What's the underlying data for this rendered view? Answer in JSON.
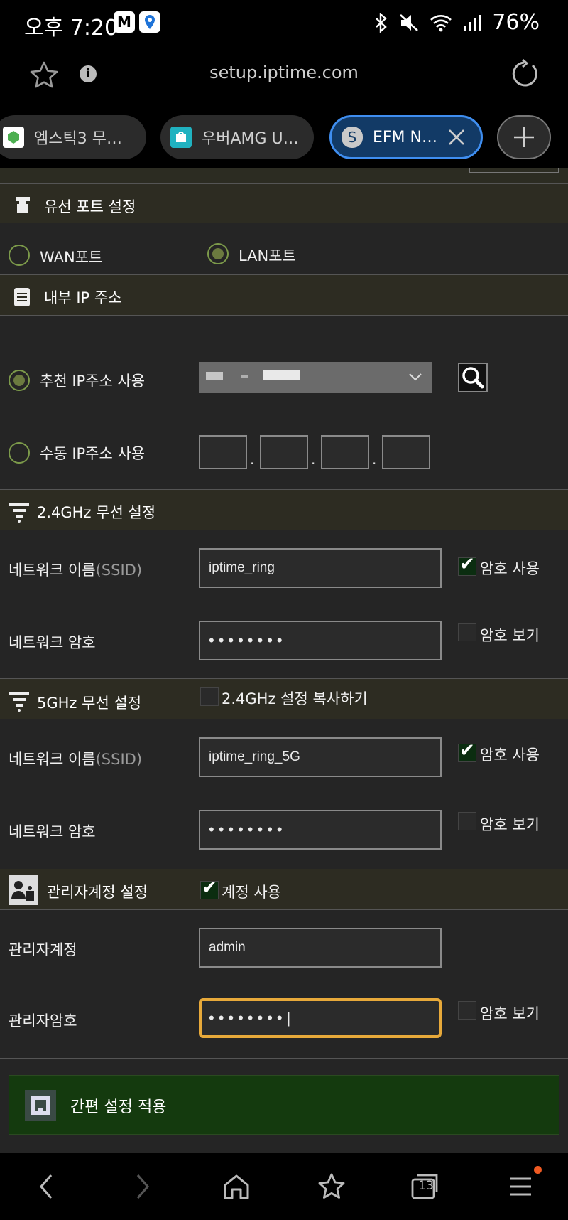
{
  "status_bar": {
    "time": "오후 7:20",
    "battery": "76%",
    "icons": [
      "m-app-icon",
      "map-pin-icon",
      "bluetooth-icon",
      "mute-icon",
      "wifi-icon",
      "signal-icon"
    ]
  },
  "browser": {
    "url": "setup.iptime.com",
    "tabs": [
      {
        "label": "엠스틱3 무…",
        "active": false
      },
      {
        "label": "우버AMG U…",
        "active": false
      },
      {
        "label": "EFM N…",
        "favicon_letter": "S",
        "active": true
      }
    ],
    "tab_count": "13"
  },
  "wired_port": {
    "title": "유선 포트 설정",
    "options": [
      {
        "label": "WAN포트",
        "selected": false
      },
      {
        "label": "LAN포트",
        "selected": true
      }
    ]
  },
  "internal_ip": {
    "title": "내부 IP 주소",
    "recommended_label": "추천 IP주소 사용",
    "recommended_selected": true,
    "manual_label": "수동 IP주소 사용",
    "manual_selected": false,
    "manual_sep": "."
  },
  "wifi_24": {
    "title": "2.4GHz 무선 설정",
    "ssid_label": "네트워크 이름",
    "ssid_sub": "(SSID)",
    "ssid_value": "iptime_ring",
    "use_password_label": "암호 사용",
    "use_password_checked": true,
    "password_label": "네트워크 암호",
    "password_value": "••••••••",
    "show_password_label": "암호 보기",
    "show_password_checked": false
  },
  "wifi_5": {
    "title": "5GHz 무선 설정",
    "copy_label": "2.4GHz 설정 복사하기",
    "copy_checked": false,
    "ssid_label": "네트워크 이름",
    "ssid_sub": "(SSID)",
    "ssid_value": "iptime_ring_5G",
    "use_password_label": "암호 사용",
    "use_password_checked": true,
    "password_label": "네트워크 암호",
    "password_value": "••••••••",
    "show_password_label": "암호 보기",
    "show_password_checked": false
  },
  "admin": {
    "title": "관리자계정 설정",
    "use_account_label": "계정 사용",
    "use_account_checked": true,
    "account_label": "관리자계정",
    "account_value": "admin",
    "password_label": "관리자암호",
    "password_value": "••••••••|",
    "show_password_label": "암호 보기",
    "show_password_checked": false
  },
  "apply_button": {
    "label": "간편 설정 적용"
  },
  "colors": {
    "section_bg": "#2d2c22",
    "content_bg": "#252525",
    "radio_green": "#7c9a4a",
    "apply_green": "#143a0e",
    "focus_border": "#e7a93a",
    "active_tab": "#123a66"
  }
}
